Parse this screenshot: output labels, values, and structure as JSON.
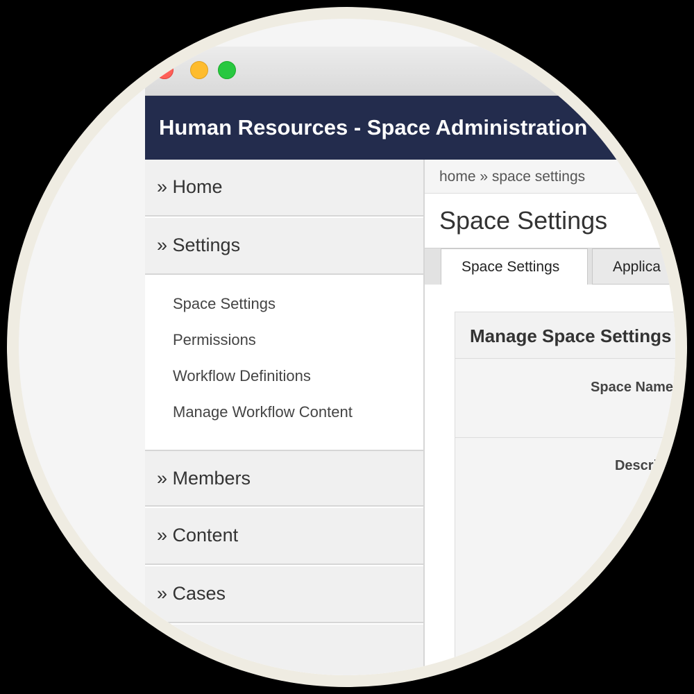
{
  "window": {
    "header_title": "Human Resources - Space Administration"
  },
  "sidebar": {
    "items": [
      {
        "label": "» Home"
      },
      {
        "label": "» Settings"
      },
      {
        "label": "» Members"
      },
      {
        "label": "» Content"
      },
      {
        "label": "» Cases"
      }
    ],
    "settings_submenu": [
      {
        "label": "Space Settings"
      },
      {
        "label": "Permissions"
      },
      {
        "label": "Workflow Definitions"
      },
      {
        "label": "Manage Workflow Content"
      }
    ]
  },
  "main": {
    "breadcrumb": "home » space settings",
    "page_title": "Space Settings",
    "tabs": [
      {
        "label": "Space Settings"
      },
      {
        "label": "Applica"
      }
    ],
    "panel": {
      "title": "Manage Space Settings",
      "fields": [
        {
          "label": "Space Name"
        },
        {
          "label": "Description"
        }
      ]
    }
  },
  "colors": {
    "header_bg": "#232c4d",
    "close_light": "#fe5f57",
    "minimize_light": "#febc2e",
    "zoom_light": "#28c840",
    "frame_ring": "#efece2"
  }
}
